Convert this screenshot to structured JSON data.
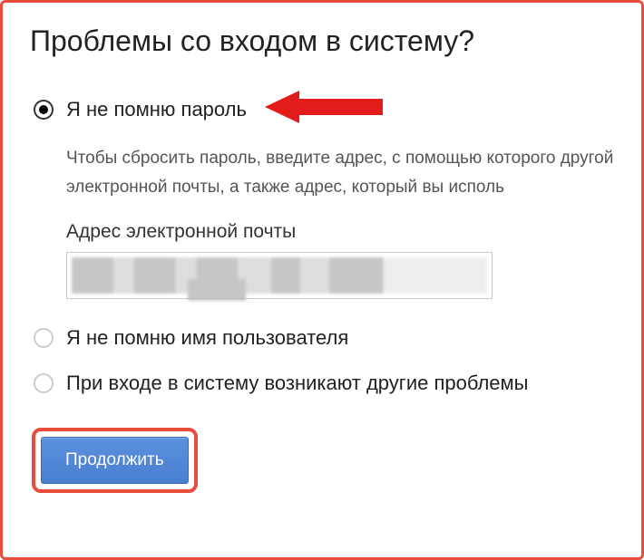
{
  "title": "Проблемы со входом в систему?",
  "options": {
    "forgot_password": {
      "label": "Я не помню пароль",
      "help_text": "Чтобы сбросить пароль, введите адрес, с помощью которого другой электронной почты, а также адрес, который вы исполь",
      "email_label": "Адрес электронной почты"
    },
    "forgot_username": {
      "label": "Я не помню имя пользователя"
    },
    "other_problems": {
      "label": "При входе в систему возникают другие проблемы"
    }
  },
  "continue_label": "Продолжить"
}
